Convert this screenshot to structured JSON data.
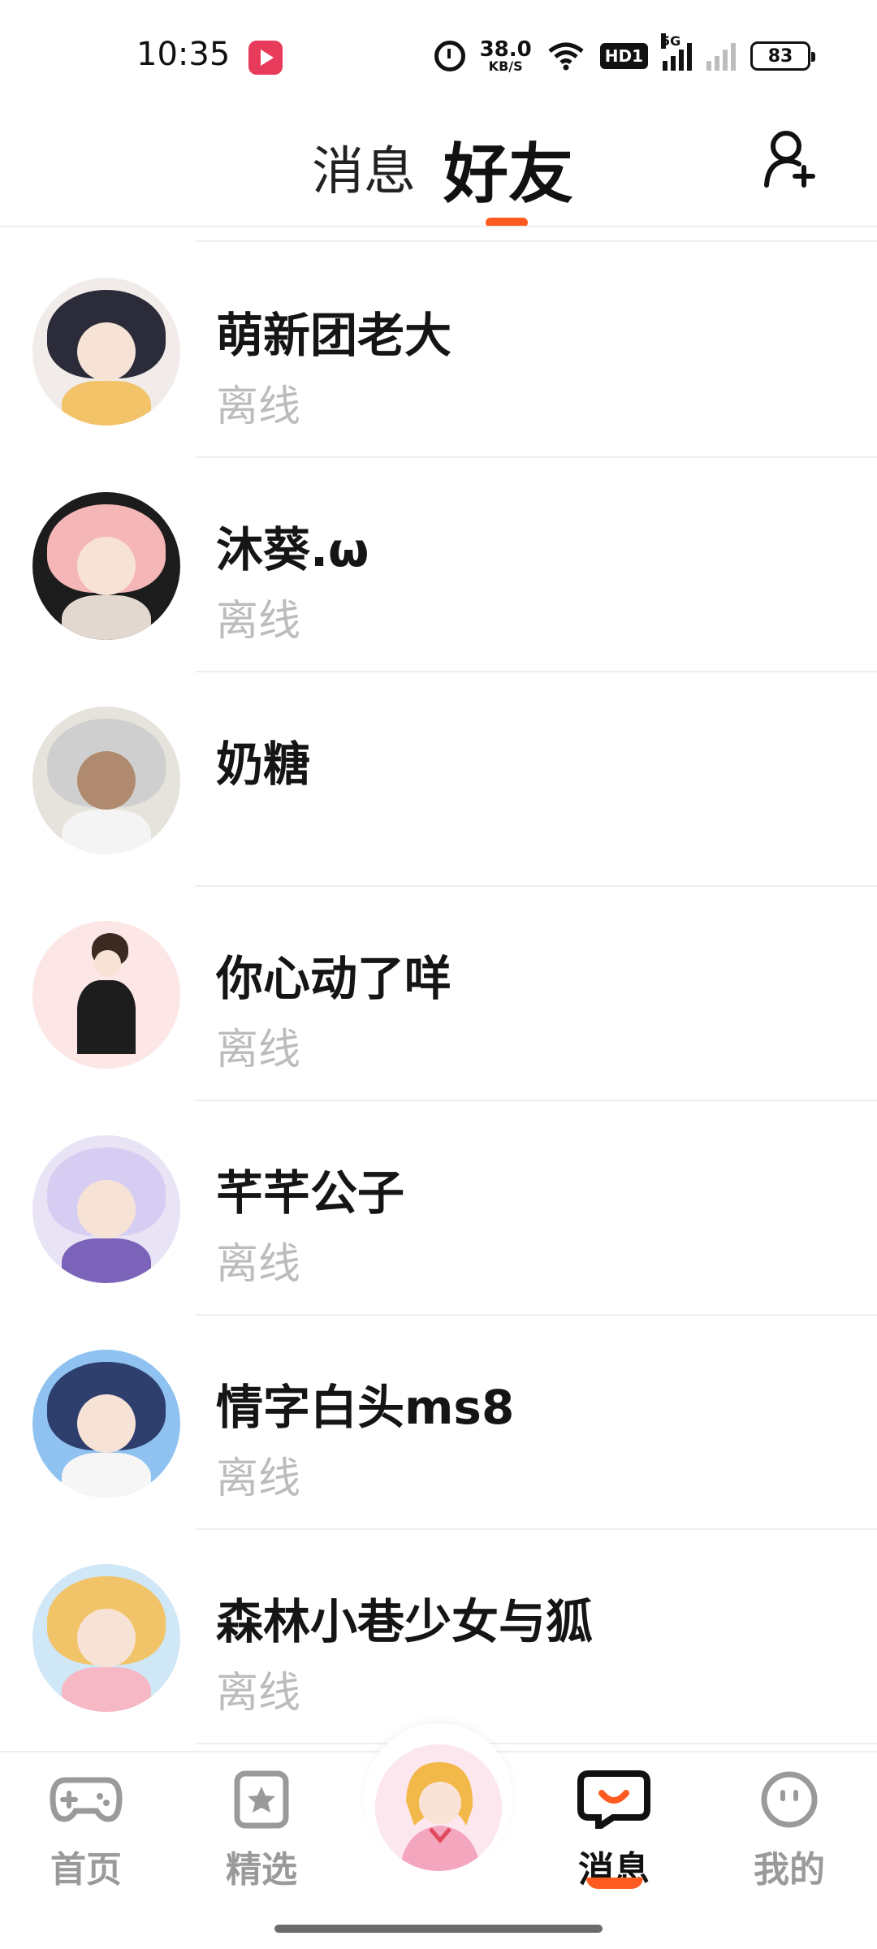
{
  "status_bar": {
    "time": "10:35",
    "speed_value": "38.0",
    "speed_unit": "KB/S",
    "hd_badge": "HD1",
    "network": "5G",
    "battery": "83",
    "icons": [
      "alarm-icon",
      "wifi-icon",
      "hd-icon",
      "signal-icon",
      "signal-icon-no-sim",
      "battery-icon"
    ]
  },
  "header": {
    "tab_messages": "消息",
    "tab_friends": "好友",
    "active_tab": "好友",
    "accent_color": "#ff5a1f",
    "add_friend_icon": "add-friend-icon"
  },
  "friends": [
    {
      "name": "萌新团老大",
      "status": "离线",
      "avatar_colors": [
        "#2b2b3a",
        "#f3c36a"
      ]
    },
    {
      "name": "沐葵.ω",
      "status": "离线",
      "avatar_colors": [
        "#1c1c1c",
        "#f4b6b6"
      ]
    },
    {
      "name": "奶糖",
      "status": "",
      "avatar_colors": [
        "#e6e2dc",
        "#cfcfcf"
      ]
    },
    {
      "name": "你心动了咩",
      "status": "离线",
      "avatar_colors": [
        "#fde6e6",
        "#3a2a22"
      ]
    },
    {
      "name": "芊芊公子",
      "status": "离线",
      "avatar_colors": [
        "#b8a9e6",
        "#e9e3f6"
      ]
    },
    {
      "name": "情字白头ms8",
      "status": "离线",
      "avatar_colors": [
        "#6fa9e6",
        "#2e3f6e"
      ]
    },
    {
      "name": "森林小巷少女与狐",
      "status": "离线",
      "avatar_colors": [
        "#cfe7f6",
        "#f2c46a"
      ]
    }
  ],
  "bottom_nav": {
    "items": [
      {
        "label": "首页",
        "icon": "gamepad-icon"
      },
      {
        "label": "精选",
        "icon": "star-bookmark-icon"
      },
      {
        "label": "消息",
        "icon": "chat-bubble-icon"
      },
      {
        "label": "我的",
        "icon": "face-icon"
      }
    ],
    "active": "消息",
    "center_icon": "avatar-center-icon"
  }
}
